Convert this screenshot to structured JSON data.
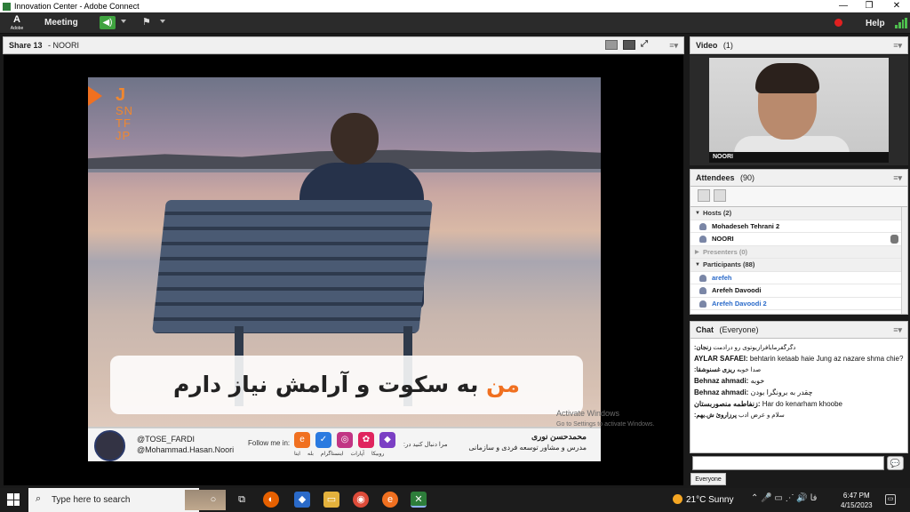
{
  "window": {
    "title": "Innovation Center - Adobe Connect",
    "minimize": "—",
    "maximize": "❐",
    "close": "✕"
  },
  "menubar": {
    "logo_letter": "A",
    "logo_word": "Adobe",
    "meeting": "Meeting",
    "help": "Help",
    "volume_icon": "speaker-icon",
    "camera_icon": "camera-icon",
    "accent": "#3fa33f",
    "record_color": "#e02020"
  },
  "share_pod": {
    "title": "Share 13",
    "presenter": "- NOORI",
    "menu": "≡▾"
  },
  "slide": {
    "mbti": [
      "J",
      "SN",
      "TF",
      "JP"
    ],
    "caption_highlight": "من",
    "caption_rest": " به سکوت و آرامش نیاز دارم",
    "handles": [
      "@TOSE_FARDI",
      "@Mohammad.Hasan.Noori"
    ],
    "follow_label": "Follow me in:",
    "follow_fa": "مرا دنبال کنید در:",
    "socials": [
      "ایتا",
      "بله",
      "اینستاگرام",
      "آپارات",
      "روبیکا"
    ],
    "teacher_name": "محمدحسن نوری",
    "teacher_title": "مدرس و مشاور توسعه فردی و سازمانی",
    "accent": "#f07020"
  },
  "watermark": {
    "line1": "Activate Windows",
    "line2": "Go to Settings to activate Windows."
  },
  "video_pod": {
    "title": "Video",
    "count": "(1)",
    "label": "NOORI",
    "menu": "≡▾"
  },
  "attendees_pod": {
    "title": "Attendees",
    "count": "(90)",
    "menu": "≡▾",
    "hosts_label": "Hosts (2)",
    "hosts": [
      "Mohadeseh Tehrani 2",
      "NOORI"
    ],
    "presenters_label": "Presenters (0)",
    "participants_label": "Participants (88)",
    "participants": [
      "arefeh",
      "Arefeh Davoodi",
      "Arefeh Davoodi 2"
    ]
  },
  "chat_pod": {
    "title": "Chat",
    "scope": "(Everyone)",
    "menu": "≡▾",
    "messages": [
      {
        "sender": "زنجان:",
        "text": "دگرگفرمایافرازیوتوی رو درادمت"
      },
      {
        "sender": "AYLAR SAFAEI:",
        "text": "behtarin  ketaab haie Jung az nazare shma chie?"
      },
      {
        "sender": "ریزی غسنوشقا:",
        "text": "صدا خوبه"
      },
      {
        "sender": "Behnaz ahmadi:",
        "text": "خوبه"
      },
      {
        "sender": "Behnaz ahmadi:",
        "text": "چقدر به برونگرا بودن"
      },
      {
        "sender": "زنفاطمه منصوربستان:",
        "text": "Har do kenarham khoobe"
      },
      {
        "sender": "پرزاروئ ش.یهم:",
        "text": "سلام و عرض ادب"
      }
    ],
    "input_placeholder": "",
    "send": "💬",
    "tab": "Everyone"
  },
  "taskbar": {
    "search_placeholder": "Type here to search",
    "weather": "21°C  Sunny",
    "tray": "⌃ 🎤 ▭ ⋰ 🔊 فا",
    "time": "6:47 PM",
    "date": "4/15/2023",
    "notif": "▭"
  }
}
